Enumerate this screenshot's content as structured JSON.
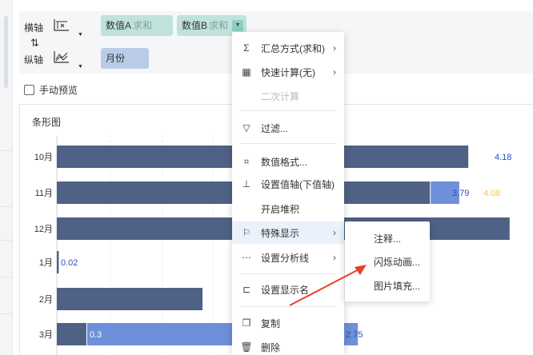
{
  "axes": {
    "x_label": "横轴",
    "y_label": "纵轴",
    "x_fields": [
      {
        "name": "数值A",
        "agg": "求和"
      },
      {
        "name": "数值B",
        "agg": "求和"
      }
    ],
    "y_fields": [
      {
        "name": "月份"
      }
    ]
  },
  "preview_label": "手动预览",
  "chart_title": "条形图",
  "context_menu": {
    "items": [
      {
        "label": "汇总方式(求和)",
        "icon": "sigma-icon"
      },
      {
        "label": "快速计算(无)",
        "icon": "calculator-icon"
      },
      {
        "label": "二次计算"
      },
      {
        "label": "过滤...",
        "icon": "filter-icon"
      },
      {
        "label": "数值格式...",
        "icon": "number-format-icon"
      },
      {
        "label": "设置值轴(下值轴)",
        "icon": "value-axis-icon"
      },
      {
        "label": "开启堆积"
      },
      {
        "label": "特殊显示",
        "icon": "flag-icon"
      },
      {
        "label": "设置分析线",
        "icon": "analysis-line-icon"
      },
      {
        "label": "设置显示名",
        "icon": "display-name-icon"
      },
      {
        "label": "复制",
        "icon": "copy-icon"
      },
      {
        "label": "删除",
        "icon": "trash-icon"
      }
    ]
  },
  "submenu": {
    "items": [
      "注释...",
      "闪烁动画...",
      "图片填充..."
    ]
  },
  "colors": {
    "series_a": "#4f6184",
    "series_b": "#6e8fd9",
    "label_blue": "#2a4fbf",
    "label_yellow": "#f2c94c",
    "label_white": "#ffffff",
    "arrow": "#e8402a"
  },
  "chart_data": {
    "type": "bar",
    "orientation": "horizontal",
    "categories": [
      "10月",
      "11月",
      "12月",
      "1月",
      "2月",
      "3月"
    ],
    "series": [
      {
        "name": "数值A",
        "values": [
          4.18,
          3.79,
          4.6,
          0.02,
          1.48,
          0.3
        ]
      },
      {
        "name": "数值B",
        "values": [
          null,
          4.08,
          null,
          null,
          null,
          2.75
        ]
      }
    ],
    "data_labels": {
      "10月": [
        "4.18"
      ],
      "11月": [
        "3.79",
        "4.08"
      ],
      "12月": [],
      "1月": [
        "0.02"
      ],
      "2月": [
        "1.48"
      ],
      "3月": [
        "0.3",
        "2.75"
      ]
    }
  }
}
